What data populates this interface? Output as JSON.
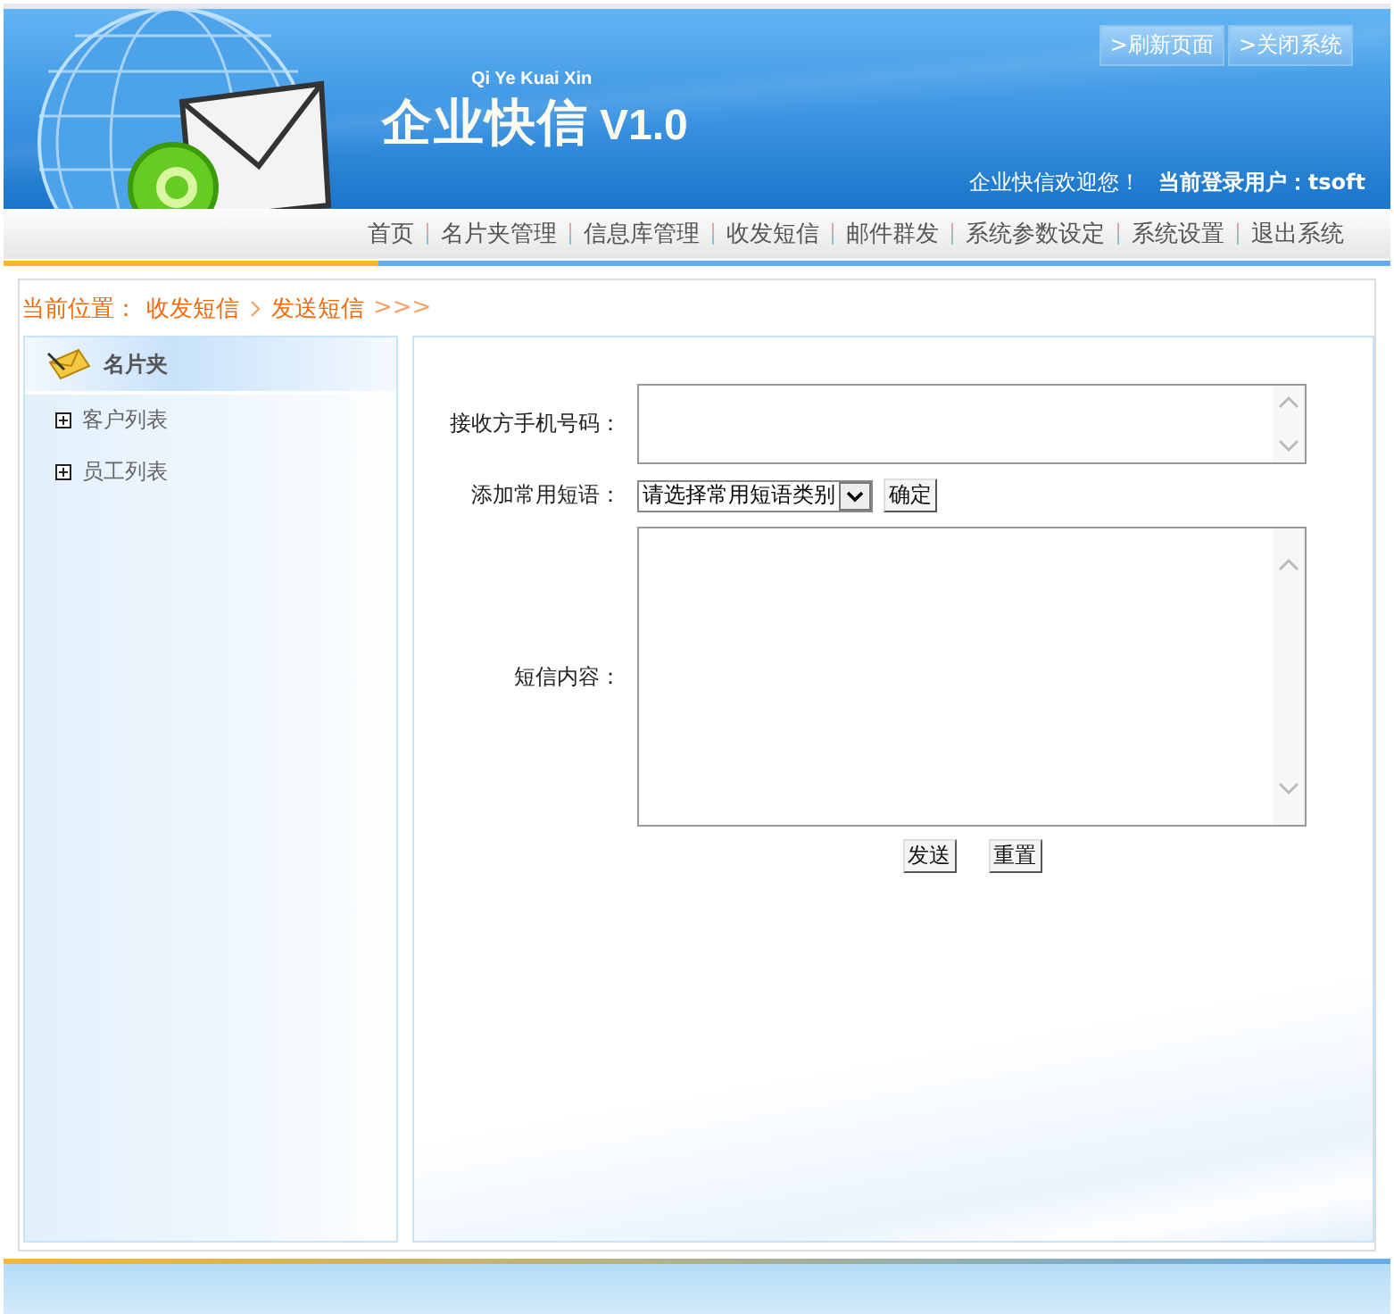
{
  "header": {
    "logo_pinyin": "Qi Ye Kuai Xin",
    "logo_title": "企业快信",
    "logo_version": "V1.0",
    "top_buttons": [
      ">刷新页面",
      ">关闭系统"
    ],
    "welcome": "企业快信欢迎您！",
    "user_label": "当前登录用户：",
    "user": "tsoft"
  },
  "nav": [
    "首页",
    "名片夹管理",
    "信息库管理",
    "收发短信",
    "邮件群发",
    "系统参数设定",
    "系统设置",
    "退出系统"
  ],
  "breadcrumb": {
    "label": "当前位置：",
    "items": [
      "收发短信",
      "发送短信"
    ],
    "tail": ">>>"
  },
  "sidebar": {
    "title": "名片夹",
    "items": [
      {
        "label": "客户列表",
        "expanded": false
      },
      {
        "label": "员工列表",
        "expanded": false
      }
    ]
  },
  "form": {
    "fields": [
      {
        "kind": "address",
        "label": "接收方手机号码："
      },
      {
        "kind": "select",
        "label": "添加常用短语：",
        "value": "请选择常用短语类别",
        "button": "确定"
      },
      {
        "kind": "textarea",
        "label": "短信内容："
      }
    ],
    "buttons": [
      "发送",
      "重置"
    ]
  }
}
